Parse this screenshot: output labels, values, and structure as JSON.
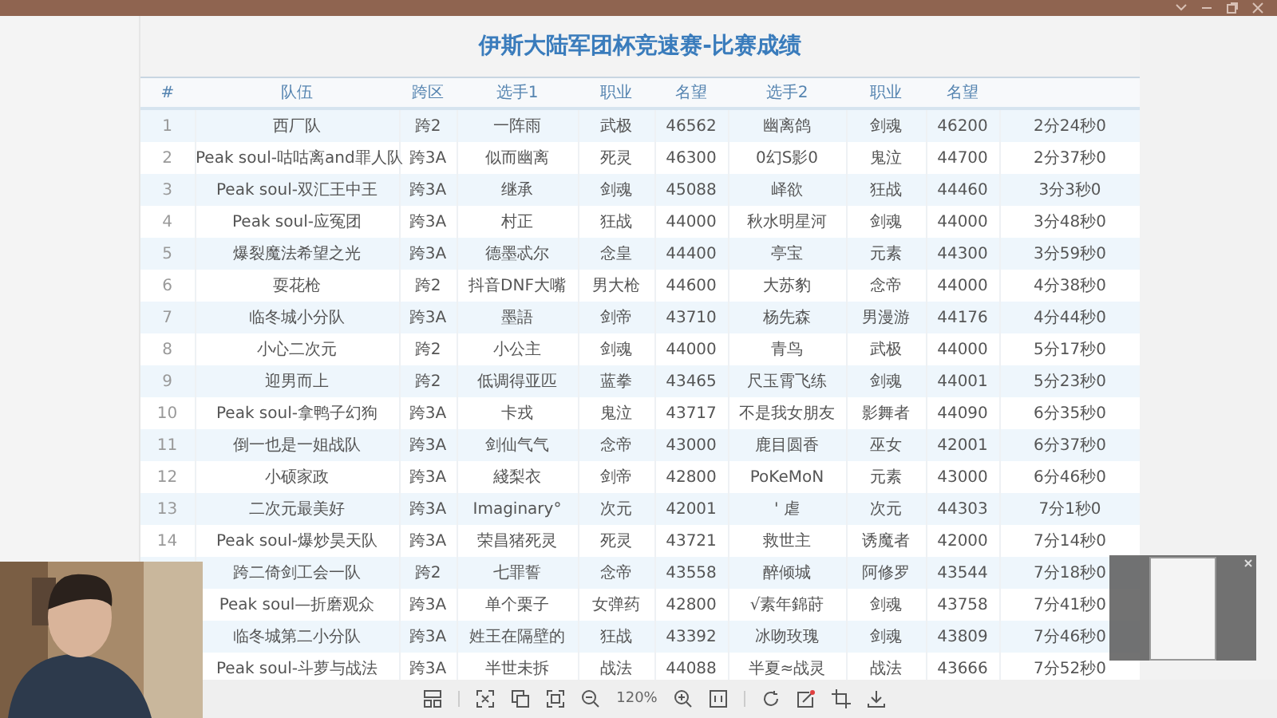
{
  "title": "伊斯大陆军团杯竞速赛-比赛成绩",
  "columns": [
    "#",
    "队伍",
    "跨区",
    "选手1",
    "职业",
    "名望",
    "选手2",
    "职业",
    "名望"
  ],
  "rows": [
    {
      "index": "1",
      "team": "西厂队",
      "server": "跨2",
      "player1": "一阵雨",
      "class1": "武极",
      "fame1": "46562",
      "player2": "幽离鸽",
      "class2": "剑魂",
      "fame2": "46200",
      "time": "2分24秒0"
    },
    {
      "index": "2",
      "team": "Peak soul-咕咕离and罪人队",
      "server": "跨3A",
      "player1": "似而幽离",
      "class1": "死灵",
      "fame1": "46300",
      "player2": "0幻S影0",
      "class2": "鬼泣",
      "fame2": "44700",
      "time": "2分37秒0"
    },
    {
      "index": "3",
      "team": "Peak soul-双汇王中王",
      "server": "跨3A",
      "player1": "继承",
      "class1": "剑魂",
      "fame1": "45088",
      "player2": "峄欲",
      "class2": "狂战",
      "fame2": "44460",
      "time": "3分3秒0"
    },
    {
      "index": "4",
      "team": "Peak soul-应冤团",
      "server": "跨3A",
      "player1": "村正",
      "class1": "狂战",
      "fame1": "44000",
      "player2": "秋水明星河",
      "class2": "剑魂",
      "fame2": "44000",
      "time": "3分48秒0"
    },
    {
      "index": "5",
      "team": "爆裂魔法希望之光",
      "server": "跨3A",
      "player1": "德墨忒尔",
      "class1": "念皇",
      "fame1": "44400",
      "player2": "亭宝",
      "class2": "元素",
      "fame2": "44300",
      "time": "3分59秒0"
    },
    {
      "index": "6",
      "team": "耍花枪",
      "server": "跨2",
      "player1": "抖音DNF大嘴",
      "class1": "男大枪",
      "fame1": "44600",
      "player2": "大苏豹",
      "class2": "念帝",
      "fame2": "44000",
      "time": "4分38秒0"
    },
    {
      "index": "7",
      "team": "临冬城小分队",
      "server": "跨3A",
      "player1": "墨語",
      "class1": "剑帝",
      "fame1": "43710",
      "player2": "杨先森",
      "class2": "男漫游",
      "fame2": "44176",
      "time": "4分44秒0"
    },
    {
      "index": "8",
      "team": "小心二次元",
      "server": "跨2",
      "player1": "小公主",
      "class1": "剑魂",
      "fame1": "44000",
      "player2": "青鸟",
      "class2": "武极",
      "fame2": "44000",
      "time": "5分17秒0"
    },
    {
      "index": "9",
      "team": "迎男而上",
      "server": "跨2",
      "player1": "低调得亚匹",
      "class1": "蓝拳",
      "fame1": "43465",
      "player2": "尺玉霄飞练",
      "class2": "剑魂",
      "fame2": "44001",
      "time": "5分23秒0"
    },
    {
      "index": "10",
      "team": "Peak soul-拿鸭子幻狗",
      "server": "跨3A",
      "player1": "卡戎",
      "class1": "鬼泣",
      "fame1": "43717",
      "player2": "不是我女朋友",
      "class2": "影舞者",
      "fame2": "44090",
      "time": "6分35秒0"
    },
    {
      "index": "11",
      "team": "倒一也是一姐战队",
      "server": "跨3A",
      "player1": "剑仙气气",
      "class1": "念帝",
      "fame1": "43000",
      "player2": "鹿目圆香",
      "class2": "巫女",
      "fame2": "42001",
      "time": "6分37秒0"
    },
    {
      "index": "12",
      "team": "小硕家政",
      "server": "跨3A",
      "player1": "綫梨衣",
      "class1": "剑帝",
      "fame1": "42800",
      "player2": "PoKeMoN",
      "class2": "元素",
      "fame2": "43000",
      "time": "6分46秒0"
    },
    {
      "index": "13",
      "team": "二次元最美好",
      "server": "跨3A",
      "player1": "Imaginary°",
      "class1": "次元",
      "fame1": "42001",
      "player2": "' 虐",
      "class2": "次元",
      "fame2": "44303",
      "time": "7分1秒0"
    },
    {
      "index": "14",
      "team": "Peak soul-爆炒昊天队",
      "server": "跨3A",
      "player1": "荣昌猪死灵",
      "class1": "死灵",
      "fame1": "43721",
      "player2": "救世主",
      "class2": "诱魔者",
      "fame2": "42000",
      "time": "7分14秒0"
    },
    {
      "team": "跨二倚剑工会一队",
      "server": "跨2",
      "player1": "七罪誓",
      "class1": "念帝",
      "fame1": "43558",
      "player2": "醉倾城",
      "class2": "阿修罗",
      "fame2": "43544",
      "time": "7分18秒0"
    },
    {
      "team": "Peak soul—折磨观众",
      "server": "跨3A",
      "player1": "单个栗子",
      "class1": "女弹药",
      "fame1": "42800",
      "player2": "√素年錦莳",
      "class2": "剑魂",
      "fame2": "43758",
      "time": "7分41秒0"
    },
    {
      "team": "临冬城第二小分队",
      "server": "跨3A",
      "player1": "姓王在隔壁的",
      "class1": "狂战",
      "fame1": "43392",
      "player2": "冰吻玫瑰",
      "class2": "剑魂",
      "fame2": "43809",
      "time": "7分46秒0"
    },
    {
      "team": "Peak soul-斗萝与战法",
      "server": "跨3A",
      "player1": "半世未拆",
      "class1": "战法",
      "fame1": "44088",
      "player2": "半夏≈战灵",
      "class2": "战法",
      "fame2": "43666",
      "time": "7分52秒0"
    }
  ],
  "zoom": "120%"
}
